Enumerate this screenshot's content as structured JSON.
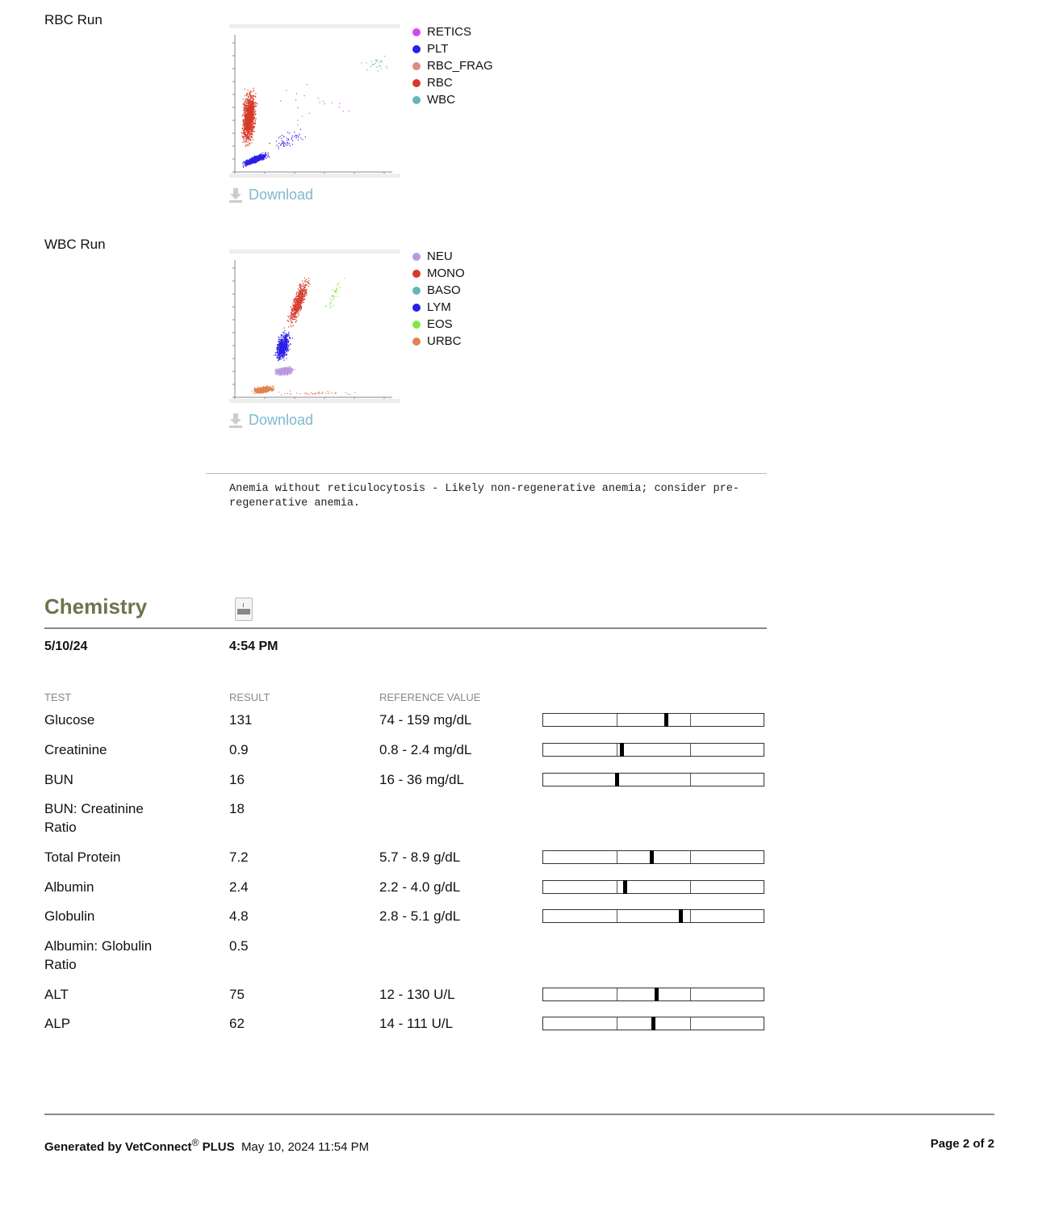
{
  "hematology": {
    "rbc_run": {
      "label": "RBC Run",
      "legend": [
        {
          "name": "RETICS",
          "color": "#d946ef"
        },
        {
          "name": "PLT",
          "color": "#2a1fe6"
        },
        {
          "name": "RBC_FRAG",
          "color": "#e08a82"
        },
        {
          "name": "RBC",
          "color": "#d63a2a"
        },
        {
          "name": "WBC",
          "color": "#63b8b5"
        }
      ],
      "download": "Download"
    },
    "wbc_run": {
      "label": "WBC Run",
      "legend": [
        {
          "name": "NEU",
          "color": "#b89ae0"
        },
        {
          "name": "MONO",
          "color": "#d63a2a"
        },
        {
          "name": "BASO",
          "color": "#63b8b5"
        },
        {
          "name": "LYM",
          "color": "#2a1fe6"
        },
        {
          "name": "EOS",
          "color": "#7ee84a"
        },
        {
          "name": "URBC",
          "color": "#e0834f"
        }
      ],
      "download": "Download"
    },
    "comment": "Anemia without reticulocytosis - Likely non-regenerative anemia; consider pre-regenerative anemia."
  },
  "chemistry": {
    "title": "Chemistry",
    "date": "5/10/24",
    "time": "4:54 PM",
    "headers": {
      "test": "TEST",
      "result": "RESULT",
      "reference": "REFERENCE VALUE"
    },
    "rows": [
      {
        "test": "Glucose",
        "result": "131",
        "reference": "74 - 159 mg/dL",
        "marker": 0.557
      },
      {
        "test": "Creatinine",
        "result": "0.9",
        "reference": "0.8 - 2.4 mg/dL",
        "marker": 0.354
      },
      {
        "test": "BUN",
        "result": "16",
        "reference": "16 - 36 mg/dL",
        "marker": 0.333
      },
      {
        "test": "BUN: Creatinine Ratio",
        "result": "18",
        "reference": "",
        "marker": null
      },
      {
        "test": "Total Protein",
        "result": "7.2",
        "reference": "5.7 - 8.9 g/dL",
        "marker": 0.49
      },
      {
        "test": "Albumin",
        "result": "2.4",
        "reference": "2.2 - 4.0 g/dL",
        "marker": 0.37
      },
      {
        "test": "Globulin",
        "result": "4.8",
        "reference": "2.8 - 5.1 g/dL",
        "marker": 0.623
      },
      {
        "test": "Albumin: Globulin Ratio",
        "result": "0.5",
        "reference": "",
        "marker": null
      },
      {
        "test": "ALT",
        "result": "75",
        "reference": "12 - 130 U/L",
        "marker": 0.511
      },
      {
        "test": "ALP",
        "result": "62",
        "reference": "14 - 111 U/L",
        "marker": 0.498
      }
    ]
  },
  "footer": {
    "generated": "Generated by VetConnect",
    "reg": "®",
    "plus": "PLUS",
    "timestamp": "May 10, 2024 11:54 PM",
    "page": "Page 2 of 2"
  }
}
